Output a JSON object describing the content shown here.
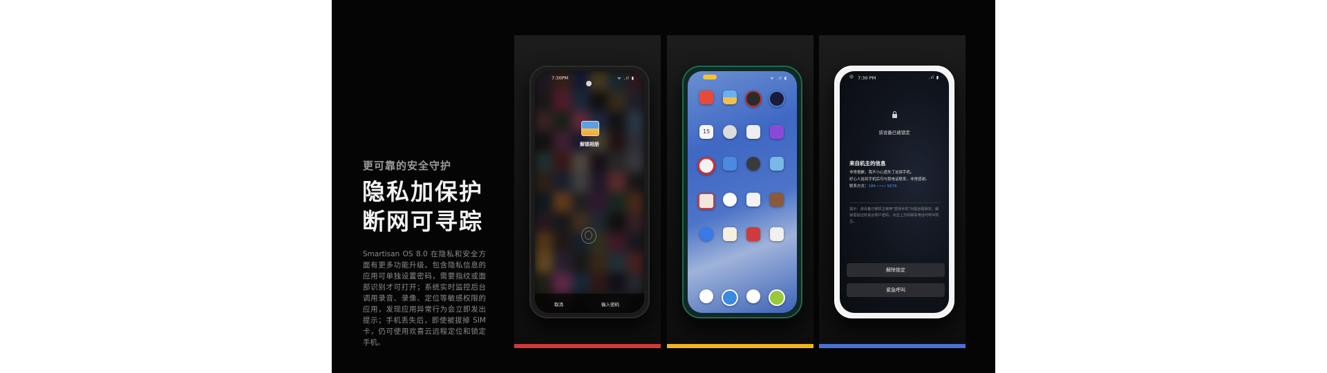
{
  "intro": {
    "eyebrow": "更可靠的安全守护",
    "headline_1": "隐私加保护",
    "headline_2": "断网可寻踪",
    "body": "Smartisan OS 8.0 在隐私和安全方面有更多功能升级。包含隐私信息的应用可单独设置密码，需要指纹或面部识别才可打开；系统实时监控后台调用录音、录像、定位等敏感权限的应用，发现应用异常行为会立即发出提示；手机丢失后，即使被拔掉 SIM 卡，仍可使用欢喜云远程定位和锁定手机。"
  },
  "phone1": {
    "time": "7:30PM",
    "signal": "ᯤ .ıl ▮",
    "unlock_label": "解锁相册",
    "cancel": "取消",
    "enter_password": "输入密码",
    "accent_color": "#d0393a"
  },
  "phone2": {
    "signal": "ᯤ .ıl ▮",
    "accent_color": "#f2b51c"
  },
  "phone3": {
    "time": "7:30 PM",
    "signal": ".ıl ▮",
    "locked_text": "该设备已被锁定",
    "owner_title": "来自机主的信息",
    "owner_line1": "非常抱歉，我不小心遗失了这部手机。",
    "owner_line2": "好心人拾到手机后可与我电话联系，非常感谢。",
    "contact_label": "联系方式：",
    "contact_number": "186 •••• 5678",
    "hint": "提示：该设备已被机主使用\"查找手机\"功能远程锁定。解锁需验证欢喜云账户密码，点击上方的联系电话可呼叫机主。",
    "unlock_button": "解除锁定",
    "emergency_button": "紧急呼叫",
    "accent_color": "#4b6fd6"
  }
}
